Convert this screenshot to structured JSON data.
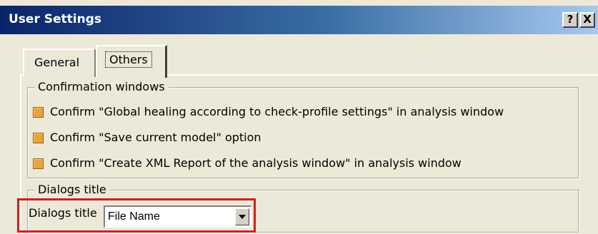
{
  "window": {
    "title": "User Settings",
    "help_button": "?",
    "close_button": "X"
  },
  "tabs": [
    {
      "label": "General",
      "selected": false
    },
    {
      "label": "Others",
      "selected": true
    }
  ],
  "confirmation": {
    "legend": "Confirmation windows",
    "items": [
      {
        "label": "Confirm \"Global healing according to check-profile settings\" in analysis window",
        "checked": true
      },
      {
        "label": "Confirm \"Save current model\" option",
        "checked": true
      },
      {
        "label": "Confirm \"Create XML Report of the analysis window\" in analysis window",
        "checked": true
      }
    ]
  },
  "dialogs": {
    "legend": "Dialogs title",
    "label": "Dialogs title",
    "selected": "File Name"
  },
  "colors": {
    "highlight_border": "#d11f1f",
    "checkbox_fill": "#e8a33a",
    "titlebar_start": "#0a246a"
  }
}
